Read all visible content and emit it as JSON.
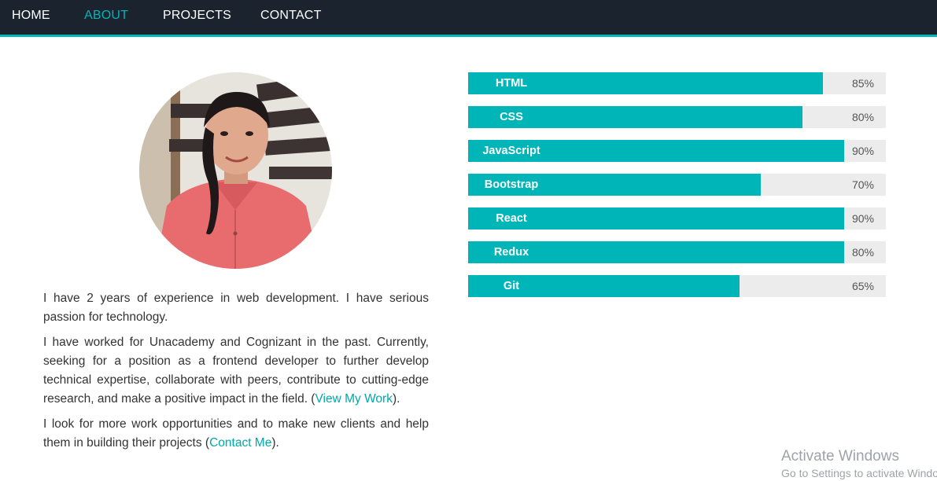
{
  "nav": {
    "items": [
      {
        "label": "HOME"
      },
      {
        "label": "ABOUT"
      },
      {
        "label": "PROJECTS"
      },
      {
        "label": "CONTACT"
      }
    ],
    "active": "ABOUT"
  },
  "about": {
    "p1": "I have 2 years of experience in web development. I have serious passion for technology.",
    "p2_text": "I have worked for Unacademy and Cognizant in the past. Currently, seeking for a position as a frontend developer to further develop technical expertise, collaborate with peers, contribute to cutting-edge research, and make a positive impact in the field. (",
    "p2_link": "View My Work",
    "p2_end": ").",
    "p3_text": "I look for more work opportunities and to make new clients and help them in building their projects (",
    "p3_link": "Contact Me",
    "p3_end": ")."
  },
  "skills": [
    {
      "name": "HTML",
      "percent_label": "85%",
      "level": 0.85
    },
    {
      "name": "CSS",
      "percent_label": "80%",
      "level": 0.8
    },
    {
      "name": "JavaScript",
      "percent_label": "90%",
      "level": 0.9
    },
    {
      "name": "Bootstrap",
      "percent_label": "70%",
      "level": 0.7
    },
    {
      "name": "React",
      "percent_label": "90%",
      "level": 0.9
    },
    {
      "name": "Redux",
      "percent_label": "80%",
      "level": 0.9
    },
    {
      "name": "Git",
      "percent_label": "65%",
      "level": 0.65
    }
  ],
  "colors": {
    "accent": "#00b5b8",
    "nav_bg": "#1b232f",
    "bar_track": "#ececec"
  },
  "watermark": {
    "line1": "Activate Windows",
    "line2": "Go to Settings to activate Windows."
  }
}
